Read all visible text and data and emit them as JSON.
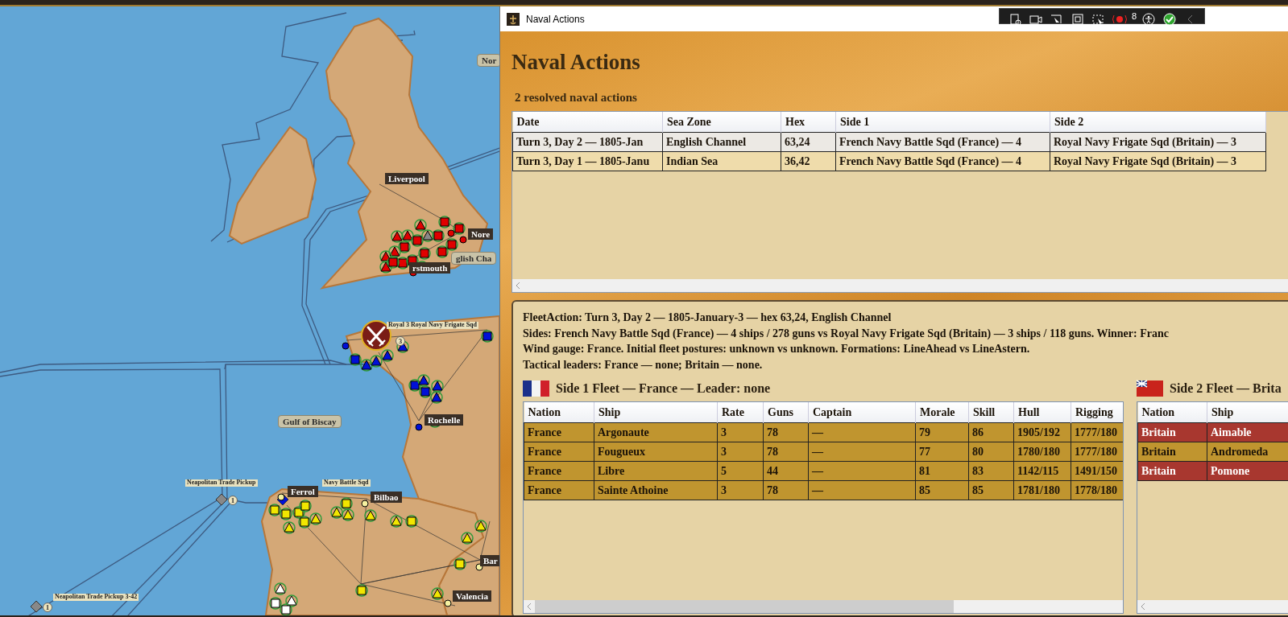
{
  "map": {
    "labels": [
      {
        "kind": "sea_zone",
        "text": "Nor"
      },
      {
        "kind": "port",
        "text": "Liverpool"
      },
      {
        "kind": "port",
        "text": "Nore"
      },
      {
        "kind": "port",
        "text": "rstmouth"
      },
      {
        "kind": "sea_zone",
        "text": "glish Cha"
      },
      {
        "kind": "unit",
        "text": "Royal 3 Royal Navy Frigate Sqd"
      },
      {
        "kind": "port",
        "text": "Rochelle"
      },
      {
        "kind": "sea_zone",
        "text": "Gulf of Biscay"
      },
      {
        "kind": "unit",
        "text": "Neapolitan Trade Pickup"
      },
      {
        "kind": "port",
        "text": "Ferrol"
      },
      {
        "kind": "unit",
        "text": "Navy Battle Sqd"
      },
      {
        "kind": "port",
        "text": "Bilbao"
      },
      {
        "kind": "port",
        "text": "Bar"
      },
      {
        "kind": "port",
        "text": "Valencia"
      },
      {
        "kind": "unit",
        "text": "Neapolitan Trade Pickup 3-42"
      },
      {
        "kind": "count",
        "text": "3"
      },
      {
        "kind": "count",
        "text": "1"
      },
      {
        "kind": "count",
        "text": "1"
      }
    ]
  },
  "window": {
    "title": "Naval Actions"
  },
  "toolbar": {
    "counter": "8"
  },
  "header": {
    "title": "Naval Actions",
    "subtitle": "2 resolved naval actions"
  },
  "actions_table": {
    "columns": [
      "Date",
      "Sea Zone",
      "Hex",
      "Side 1",
      "Side 2"
    ],
    "rows": [
      {
        "selected": true,
        "cells": [
          "Turn 3, Day 2 — 1805-Jan",
          "English Channel",
          "63,24",
          "French Navy Battle Sqd (France) — 4",
          "Royal Navy Frigate Sqd (Britain) — 3"
        ]
      },
      {
        "selected": false,
        "cells": [
          "Turn 3, Day 1 — 1805-Janu",
          "Indian Sea",
          "36,42",
          "French Navy Battle Sqd (France) — 4",
          "Royal Navy Frigate Sqd (Britain) — 3"
        ]
      }
    ]
  },
  "detail": {
    "lines": [
      "FleetAction: Turn 3, Day 2 — 1805-January-3 — hex 63,24, English Channel",
      "Sides: French Navy Battle Sqd (France) — 4 ships / 278 guns vs Royal Navy Frigate Sqd (Britain) — 3 ships / 118 guns. Winner: Franc",
      "Wind gauge: France. Initial fleet postures: unknown vs unknown. Formations: LineAhead vs LineAstern.",
      "Tactical leaders: France — none; Britain — none."
    ],
    "fleets": [
      {
        "kind": "france",
        "title": "Side 1 Fleet — France — Leader: none",
        "columns": [
          "Nation",
          "Ship",
          "Rate",
          "Guns",
          "Captain",
          "Morale",
          "Skill",
          "Hull",
          "Rigging"
        ],
        "rows": [
          {
            "highlighted": false,
            "cells": [
              "France",
              "Argonaute",
              "3",
              "78",
              "—",
              "79",
              "86",
              "1905/192",
              "1777/180"
            ]
          },
          {
            "highlighted": false,
            "cells": [
              "France",
              "Fougueux",
              "3",
              "78",
              "—",
              "77",
              "80",
              "1780/180",
              "1777/180"
            ]
          },
          {
            "highlighted": false,
            "cells": [
              "France",
              "Libre",
              "5",
              "44",
              "—",
              "81",
              "83",
              "1142/115",
              "1491/150"
            ]
          },
          {
            "highlighted": false,
            "cells": [
              "France",
              "Sainte Athoine",
              "3",
              "78",
              "—",
              "85",
              "85",
              "1781/180",
              "1778/180"
            ]
          }
        ]
      },
      {
        "kind": "britain",
        "title": "Side 2 Fleet — Brita",
        "columns": [
          "Nation",
          "Ship"
        ],
        "rows": [
          {
            "highlighted": true,
            "cells": [
              "Britain",
              "Aimable"
            ]
          },
          {
            "highlighted": false,
            "cells": [
              "Britain",
              "Andromeda"
            ]
          },
          {
            "highlighted": true,
            "cells": [
              "Britain",
              "Pomone"
            ]
          }
        ]
      }
    ]
  }
}
